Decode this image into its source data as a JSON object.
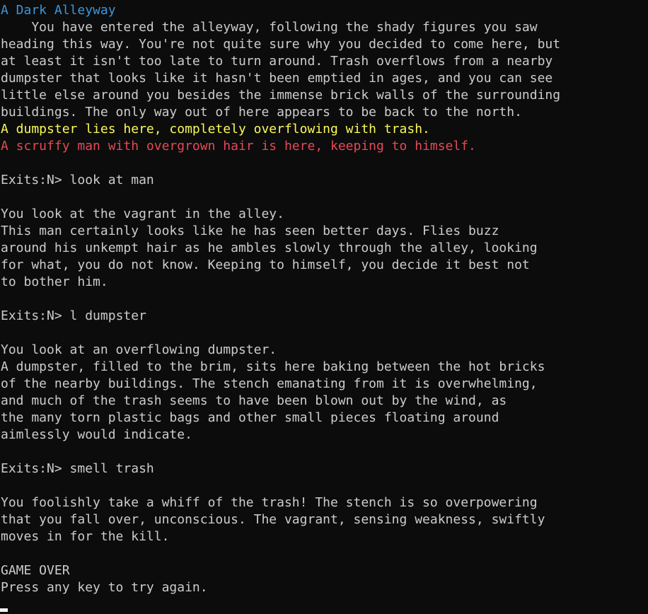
{
  "colors": {
    "background": "#0c0c0c",
    "text": "#cccccc",
    "room_title": "#3a96dd",
    "object_yellow": "#f9f95a",
    "npc_red": "#e74856",
    "cursor": "#f2f2f2"
  },
  "room": {
    "title": "A Dark Alleyway",
    "description": [
      "    You have entered the alleyway, following the shady figures you saw",
      "heading this way. You're not quite sure why you decided to come here, but",
      "at least it isn't too late to turn around. Trash overflows from a nearby",
      "dumpster that looks like it hasn't been emptied in ages, and you can see",
      "little else around you besides the immense brick walls of the surrounding",
      "buildings. The only way out of here appears to be back to the north."
    ],
    "object_line": "A dumpster lies here, completely overflowing with trash.",
    "npc_line": "A scruffy man with overgrown hair is here, keeping to himself."
  },
  "prompt_label": "Exits:N> ",
  "commands": [
    {
      "input": "look at man",
      "response": [
        "You look at the vagrant in the alley.",
        "This man certainly looks like he has seen better days. Flies buzz",
        "around his unkempt hair as he ambles slowly through the alley, looking",
        "for what, you do not know. Keeping to himself, you decide it best not",
        "to bother him."
      ]
    },
    {
      "input": "l dumpster",
      "response": [
        "You look at an overflowing dumpster.",
        "A dumpster, filled to the brim, sits here baking between the hot bricks",
        "of the nearby buildings. The stench emanating from it is overwhelming,",
        "and much of the trash seems to have been blown out by the wind, as",
        "the many torn plastic bags and other small pieces floating around",
        "aimlessly would indicate."
      ]
    },
    {
      "input": "smell trash",
      "response": [
        "You foolishly take a whiff of the trash! The stench is so overpowering",
        "that you fall over, unconscious. The vagrant, sensing weakness, swiftly",
        "moves in for the kill."
      ]
    }
  ],
  "game_over": {
    "title": "GAME OVER",
    "message": "Press any key to try again."
  }
}
